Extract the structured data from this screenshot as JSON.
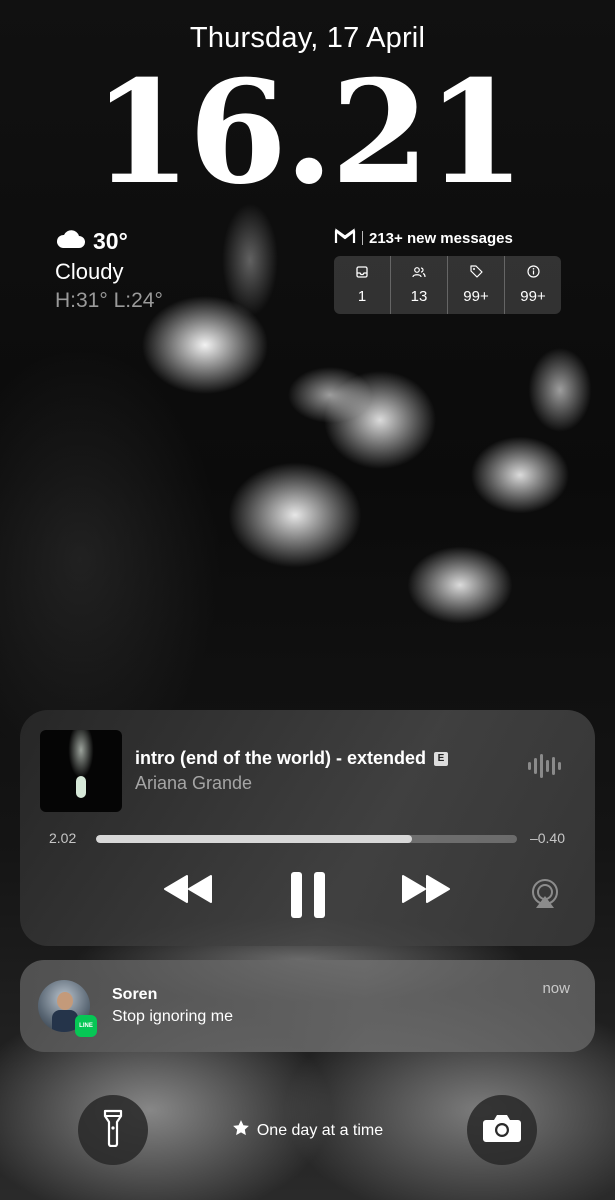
{
  "lockscreen": {
    "date": "Thursday, 17 April",
    "time": "16.21"
  },
  "weather": {
    "icon": "cloud-icon",
    "temperature": "30°",
    "condition": "Cloudy",
    "high_low": "H:31° L:24°"
  },
  "mail_widget": {
    "icon": "gmail-icon",
    "summary": "213+ new messages",
    "counters": [
      {
        "icon": "inbox-icon",
        "value": "1"
      },
      {
        "icon": "people-icon",
        "value": "13"
      },
      {
        "icon": "tag-icon",
        "value": "99+"
      },
      {
        "icon": "info-icon",
        "value": "99+"
      }
    ]
  },
  "now_playing": {
    "title": "intro (end of the world) - extended",
    "explicit_badge": "E",
    "artist": "Ariana Grande",
    "elapsed": "2.02",
    "remaining": "–0.40",
    "progress_fraction": 0.75
  },
  "notification": {
    "app": "LINE",
    "app_badge_text": "LINE",
    "sender": "Soren",
    "message": "Stop ignoring me",
    "time": "now"
  },
  "focus": {
    "icon": "star-icon",
    "label": "One day at a time"
  },
  "colors": {
    "line_green": "#06c755",
    "progress_fill": "#d8d8d8"
  }
}
